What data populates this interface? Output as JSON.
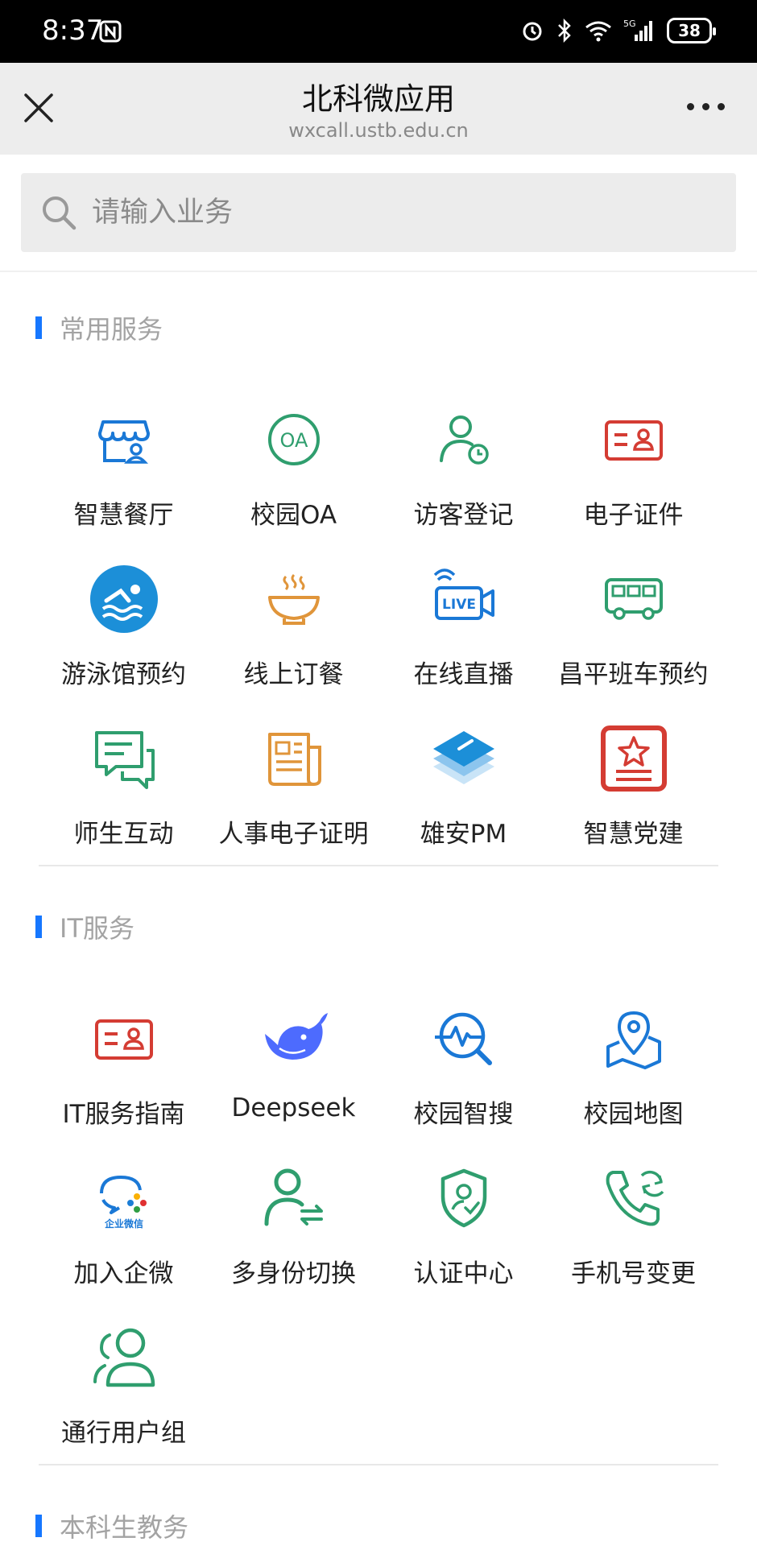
{
  "status_bar": {
    "time": "8:37",
    "battery": "38",
    "network": "5G"
  },
  "navbar": {
    "title": "北科微应用",
    "subtitle": "wxcall.ustb.edu.cn"
  },
  "search": {
    "placeholder": "请输入业务"
  },
  "colors": {
    "accent": "#1677ff",
    "blue": "#1a78d6",
    "green": "#2f9e6e",
    "red": "#d43c33",
    "orange": "#e0953a"
  },
  "sections": [
    {
      "title": "常用服务",
      "items": [
        {
          "label": "智慧餐厅",
          "icon": "restaurant-icon"
        },
        {
          "label": "校园OA",
          "icon": "oa-icon"
        },
        {
          "label": "访客登记",
          "icon": "visitor-icon"
        },
        {
          "label": "电子证件",
          "icon": "id-card-icon"
        },
        {
          "label": "游泳馆预约",
          "icon": "swimming-icon"
        },
        {
          "label": "线上订餐",
          "icon": "food-bowl-icon"
        },
        {
          "label": "在线直播",
          "icon": "live-camera-icon"
        },
        {
          "label": "昌平班车预约",
          "icon": "bus-icon"
        },
        {
          "label": "师生互动",
          "icon": "chat-icon"
        },
        {
          "label": "人事电子证明",
          "icon": "document-icon"
        },
        {
          "label": "雄安PM",
          "icon": "layers-icon"
        },
        {
          "label": "智慧党建",
          "icon": "party-star-icon"
        }
      ]
    },
    {
      "title": "IT服务",
      "items": [
        {
          "label": "IT服务指南",
          "icon": "id-card-icon"
        },
        {
          "label": "Deepseek",
          "icon": "whale-icon"
        },
        {
          "label": "校园智搜",
          "icon": "pulse-search-icon"
        },
        {
          "label": "校园地图",
          "icon": "map-pin-icon"
        },
        {
          "label": "加入企微",
          "icon": "wecom-icon",
          "icon_text": "企业微信"
        },
        {
          "label": "多身份切换",
          "icon": "user-switch-icon"
        },
        {
          "label": "认证中心",
          "icon": "shield-check-icon"
        },
        {
          "label": "手机号变更",
          "icon": "phone-refresh-icon"
        },
        {
          "label": "通行用户组",
          "icon": "user-group-icon"
        }
      ]
    },
    {
      "title": "本科生教务",
      "items": []
    }
  ]
}
